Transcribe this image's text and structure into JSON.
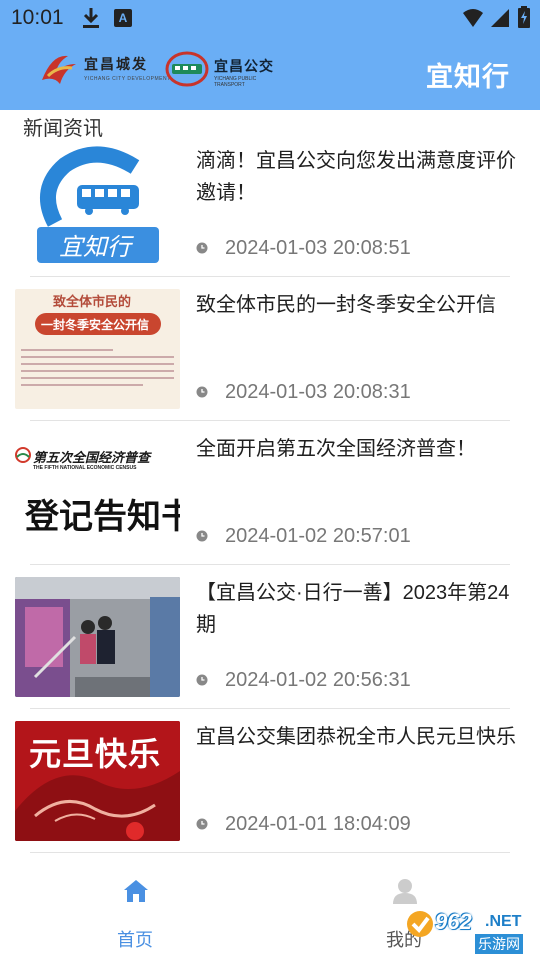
{
  "status_bar": {
    "time": "10:01"
  },
  "header": {
    "logo_left_name": "宜昌城发",
    "logo_left_sub": "YICHANG CITY DEVELOPMENT",
    "logo_right_name": "宜昌公交",
    "logo_right_sub": "YICHANG PUBLIC TRANSPORT",
    "app_title": "宜知行"
  },
  "section": {
    "title": "新闻资讯"
  },
  "news": [
    {
      "title": "滴滴！宜昌公交向您发出满意度评价邀请！",
      "date": "2024-01-03 20:08:51",
      "thumb_text": "宜知行"
    },
    {
      "title": "致全体市民的一封冬季安全公开信",
      "date": "2024-01-03 20:08:31",
      "thumb_line1": "致全体市民的",
      "thumb_line2": "一封冬季安全公开信"
    },
    {
      "title": "全面开启第五次全国经济普查！",
      "date": "2024-01-02 20:57:01",
      "thumb_line1": "第五次全国经济普查",
      "thumb_line2": "THE FIFTH NATIONAL ECONOMIC CENSUS",
      "thumb_line3": "登记告知书"
    },
    {
      "title": "【宜昌公交·日行一善】2023年第24期",
      "date": "2024-01-02 20:56:31"
    },
    {
      "title": "宜昌公交集团恭祝全市人民元旦快乐",
      "date": "2024-01-01 18:04:09",
      "thumb_text": "元旦快乐"
    }
  ],
  "bottom_nav": {
    "home_label": "首页",
    "mine_label": "我的"
  },
  "watermark": {
    "brand": "962",
    "suffix": ".NET",
    "sub": "乐游网"
  },
  "colors": {
    "header_bg": "#6aaef5",
    "accent": "#4a90e2"
  }
}
